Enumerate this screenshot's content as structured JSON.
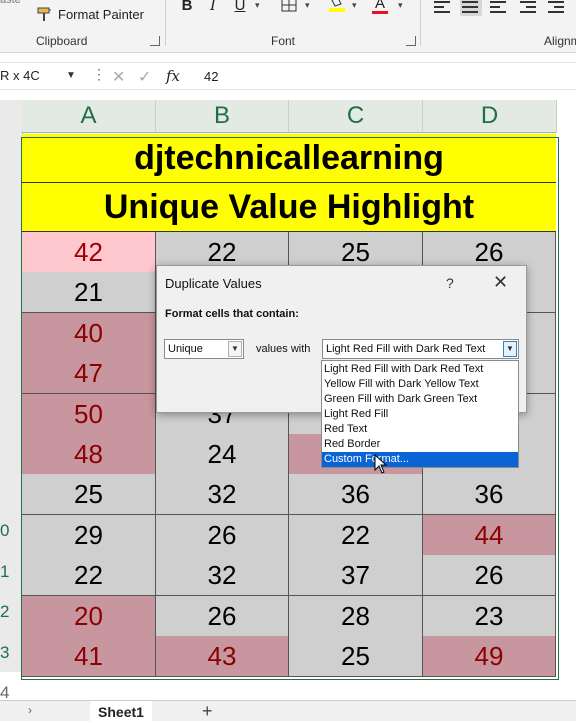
{
  "ribbon": {
    "paste_fragment": "aste",
    "format_painter": "Format Painter",
    "clipboard_label": "Clipboard",
    "font_label": "Font",
    "alignment_label": "Alignm",
    "bold": "B",
    "italic": "I",
    "underline": "U",
    "font_color_letter": "A"
  },
  "formula_bar": {
    "name_box": "R x 4C",
    "value": "42",
    "fx": "fx"
  },
  "columns": [
    "A",
    "B",
    "C",
    "D"
  ],
  "row_numbers": [
    "",
    "",
    "",
    "",
    "",
    "",
    "",
    "",
    "",
    "",
    "0",
    "1",
    "2",
    "3",
    "4"
  ],
  "titles": {
    "line1": "djtechnicallearning",
    "line2": "Unique Value Highlight"
  },
  "grid": {
    "rows": [
      [
        "42",
        "22",
        "25",
        "26"
      ],
      [
        "21",
        "",
        "",
        ""
      ],
      [
        "40",
        "",
        "",
        ""
      ],
      [
        "47",
        "",
        "",
        ""
      ],
      [
        "50",
        "37",
        "",
        ""
      ],
      [
        "48",
        "24",
        "",
        ""
      ],
      [
        "25",
        "32",
        "36",
        "36"
      ],
      [
        "29",
        "26",
        "22",
        "44"
      ],
      [
        "22",
        "32",
        "37",
        "26"
      ],
      [
        "20",
        "26",
        "28",
        "23"
      ],
      [
        "41",
        "43",
        "25",
        "49"
      ]
    ]
  },
  "dialog": {
    "title": "Duplicate Values",
    "help": "?",
    "close": "✕",
    "label": "Format cells that contain:",
    "rule_type": "Unique",
    "values_with": "values with",
    "format_selected": "Light Red Fill with Dark Red Text",
    "options": [
      "Light Red Fill with Dark Red Text",
      "Yellow Fill with Dark Yellow Text",
      "Green Fill with Dark Green Text",
      "Light Red Fill",
      "Red Text",
      "Red Border",
      "Custom Format..."
    ]
  },
  "tabs": {
    "sheet": "Sheet1",
    "add": "+"
  },
  "colors": {
    "title_fill": "#ffff00",
    "cell_gray": "#cfcfcf",
    "duplicate_fill": "#c8969e",
    "light_red_fill": "#ffc7ce",
    "excel_green": "#217346",
    "highlight": "#0a64d6"
  }
}
